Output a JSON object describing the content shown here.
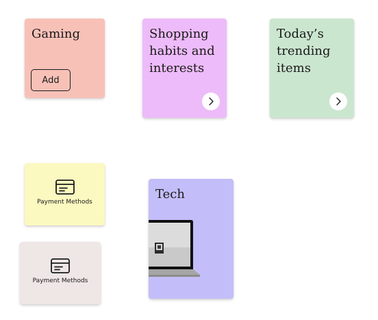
{
  "colors": {
    "gaming_bg": "#f8c1b8",
    "shopping_bg": "#edbbf9",
    "trending_bg": "#cbe6cf",
    "tech_bg": "#c3bef9",
    "payment_yellow_bg": "#fbf9c0",
    "payment_pink_bg": "#efe6e6"
  },
  "cards": {
    "gaming": {
      "title": "Gaming",
      "button_label": "Add"
    },
    "shopping": {
      "title": "Shopping habits and interests",
      "action_icon": "chevron-right-icon"
    },
    "trending": {
      "title": "Today’s trending items",
      "action_icon": "chevron-right-icon"
    },
    "tech": {
      "title": "Tech",
      "image": "laptop-image"
    }
  },
  "payment_tiles": [
    {
      "label": "Payment Methods",
      "icon": "credit-card-icon"
    },
    {
      "label": "Payment Methods",
      "icon": "credit-card-icon"
    }
  ]
}
